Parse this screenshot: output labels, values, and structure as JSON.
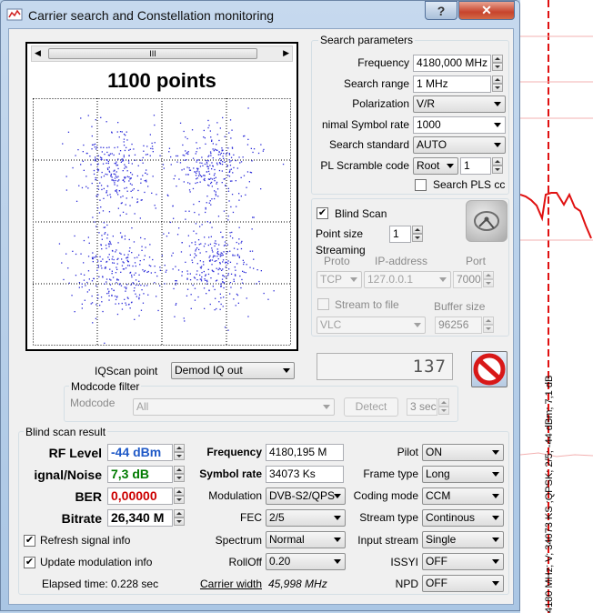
{
  "window": {
    "title": "Carrier search and Constellation monitoring",
    "help_label": "?",
    "close_label": "✕"
  },
  "plot": {
    "title": "1100 points",
    "scroll_thumb": "III"
  },
  "search": {
    "group_title": "Search parameters",
    "frequency_label": "Frequency",
    "frequency_value": "4180,000 MHz",
    "range_label": "Search range",
    "range_value": "1 MHz",
    "polarization_label": "Polarization",
    "polarization_value": "V/R",
    "symbol_rate_label": "nimal Symbol rate",
    "symbol_rate_value": "1000",
    "standard_label": "Search standard",
    "standard_value": "AUTO",
    "pls_label": "PL Scramble code",
    "pls_mode": "Root",
    "pls_value": "1",
    "search_pls_label": "Search PLS cc"
  },
  "blind": {
    "blind_scan_label": "Blind Scan",
    "blind_scan_checked": "✔",
    "point_size_label": "Point size",
    "point_size_value": "1"
  },
  "streaming": {
    "title": "Streaming",
    "proto_label": "Proto",
    "ip_label": "IP-address",
    "port_label": "Port",
    "proto_value": "TCP",
    "ip_value": "127.0.0.1",
    "port_value": "7000",
    "to_file_label": "Stream to file",
    "buffer_label": "Buffer size",
    "player_value": "VLC",
    "buffer_value": "96256"
  },
  "iq": {
    "label": "IQScan point",
    "value": "Demod IQ out",
    "counter": "137"
  },
  "modcode": {
    "title": "Modcode filter",
    "label": "Modcode",
    "value": "All",
    "detect_label": "Detect",
    "seconds_value": "3 sec"
  },
  "result": {
    "title": "Blind scan result",
    "rf_label": "RF Level",
    "rf_value": "-44 dBm",
    "sn_label": "ignal/Noise",
    "sn_value": "7,3 dB",
    "ber_label": "BER",
    "ber_value": "0,00000",
    "bitrate_label": "Bitrate",
    "bitrate_value": "26,340 M",
    "freq_label": "Frequency",
    "freq_value": "4180,195 M",
    "sr_label": "Symbol rate",
    "sr_value": "34073 Ks",
    "mod_label": "Modulation",
    "mod_value": "DVB-S2/QPS",
    "fec_label": "FEC",
    "fec_value": "2/5",
    "spectrum_label": "Spectrum",
    "spectrum_value": "Normal",
    "rolloff_label": "RollOff",
    "rolloff_value": "0.20",
    "cw_label": "Carrier width",
    "cw_value": "45,998 MHz",
    "pilot_label": "Pilot",
    "pilot_value": "ON",
    "frame_label": "Frame type",
    "frame_value": "Long",
    "coding_label": "Coding mode",
    "coding_value": "CCM",
    "stream_type_label": "Stream type",
    "stream_type_value": "Continous",
    "input_label": "Input stream",
    "input_value": "Single",
    "issyi_label": "ISSYI",
    "issyi_value": "OFF",
    "npd_label": "NPD",
    "npd_value": "OFF",
    "refresh_label": "Refresh signal info",
    "refresh_checked": "✔",
    "update_label": "Update modulation info",
    "update_checked": "✔",
    "elapsed": "Elapsed time: 0.228 sec"
  },
  "side_plot": {
    "label": "4180 MHz; V; 34073 KS ;QPSK; 2/5; -44 dBm; 7,1 dB"
  },
  "colors": {
    "accent_blue": "#1f59c7",
    "green": "#007a00",
    "red": "#cc0000",
    "trace": "#e01010"
  }
}
